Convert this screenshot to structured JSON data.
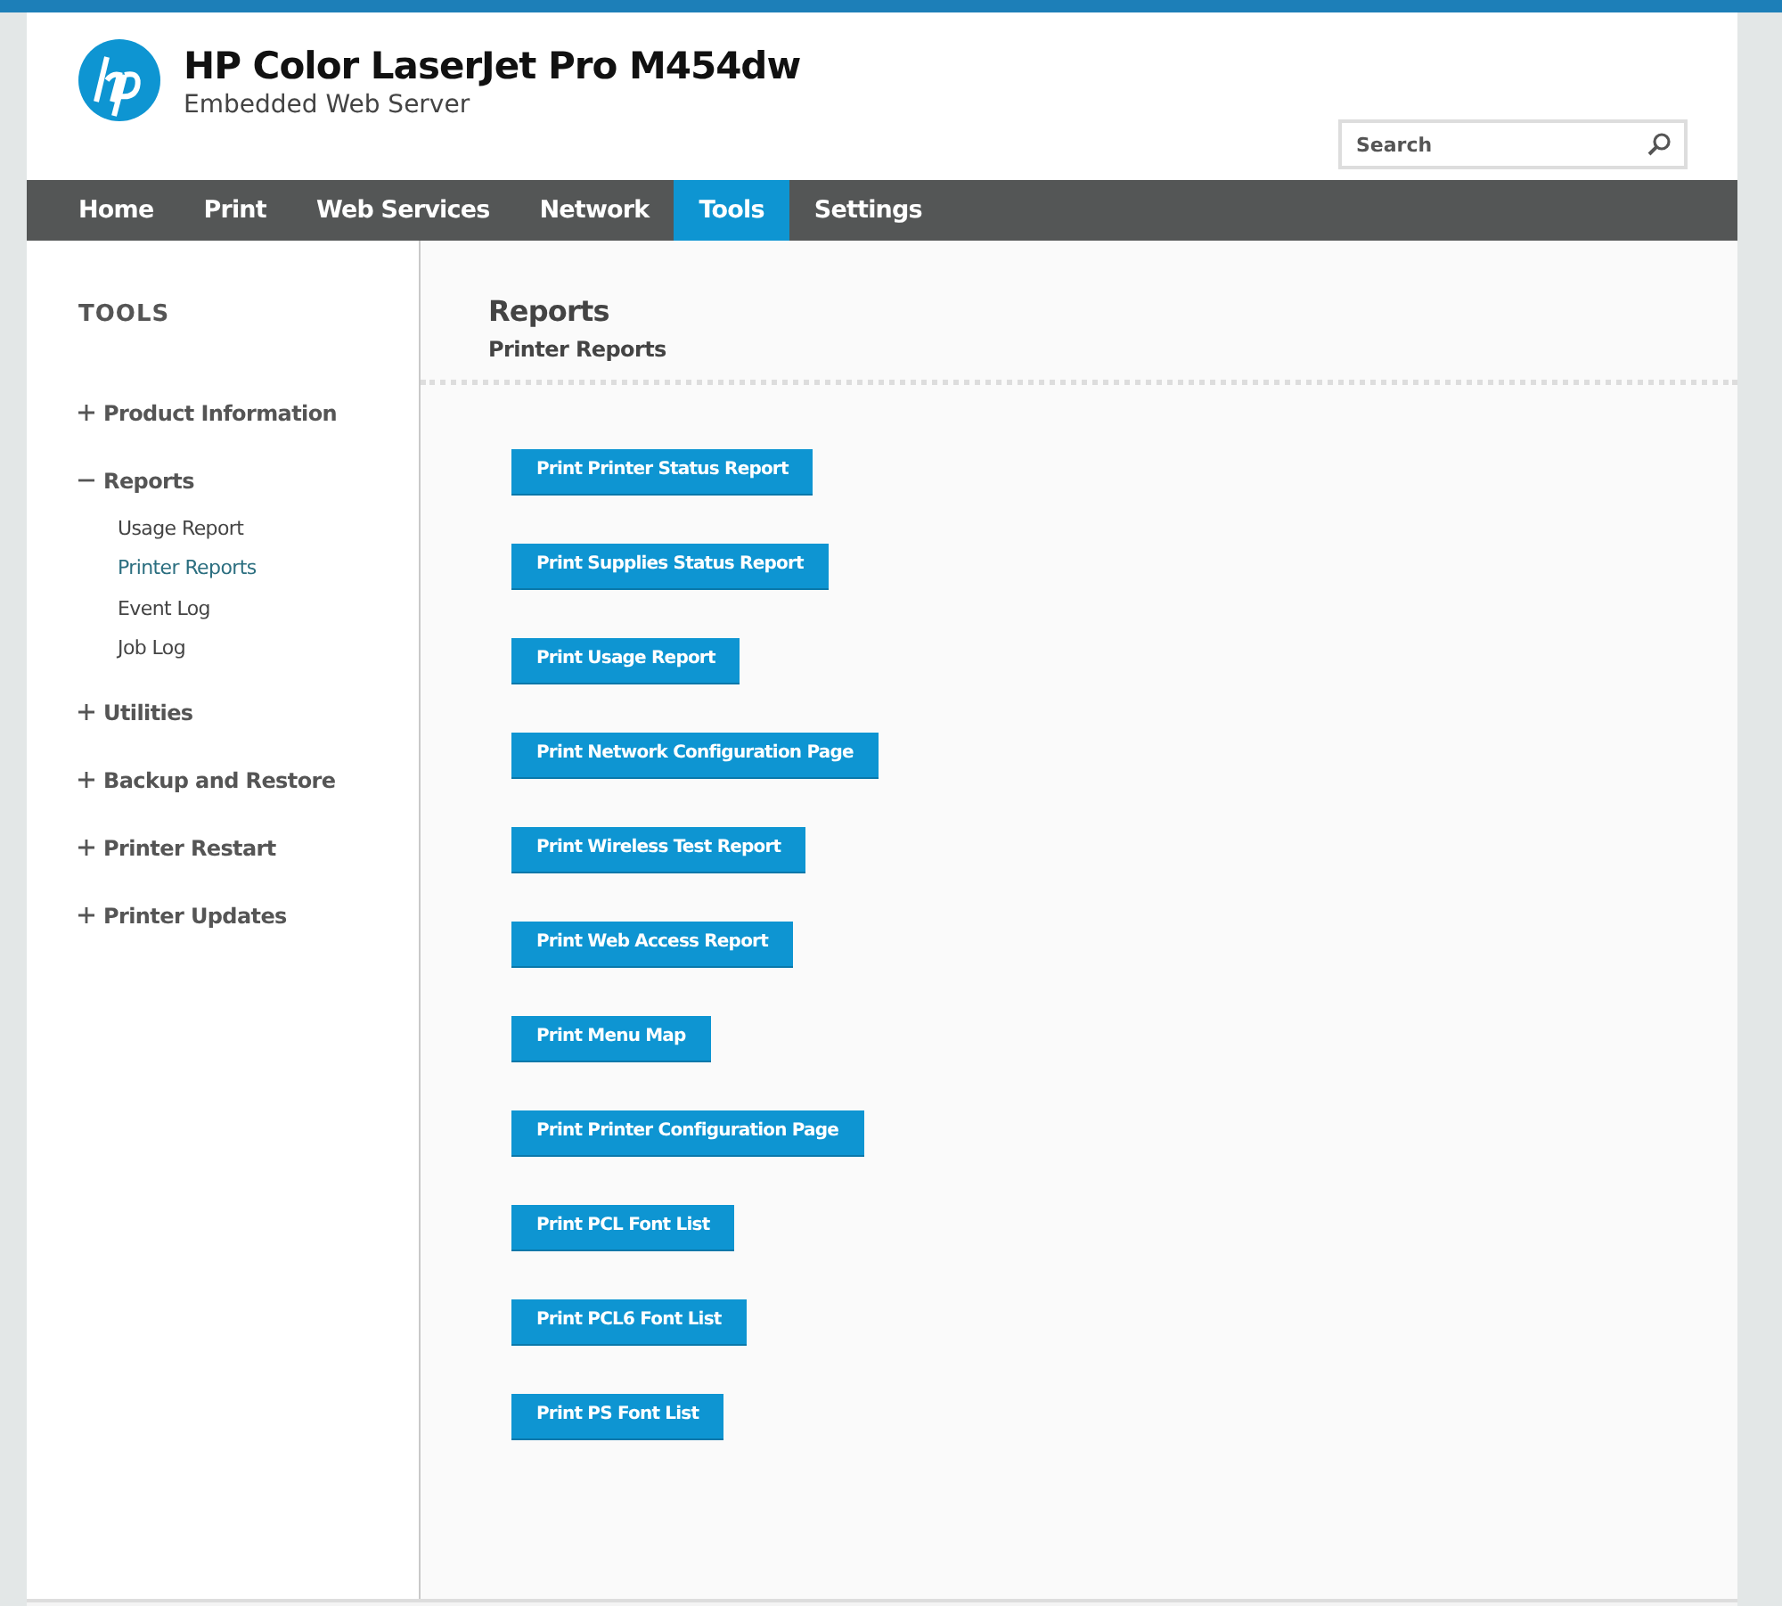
{
  "header": {
    "title": "HP Color LaserJet Pro M454dw",
    "subtitle": "Embedded Web Server"
  },
  "search": {
    "placeholder": "Search"
  },
  "tabs": [
    {
      "label": "Home",
      "selected": false
    },
    {
      "label": "Print",
      "selected": false
    },
    {
      "label": "Web Services",
      "selected": false
    },
    {
      "label": "Network",
      "selected": false
    },
    {
      "label": "Tools",
      "selected": true
    },
    {
      "label": "Settings",
      "selected": false
    }
  ],
  "sidebar": {
    "title": "TOOLS",
    "items": [
      {
        "label": "Product Information",
        "expanded": false
      },
      {
        "label": "Reports",
        "expanded": true,
        "children": [
          {
            "label": "Usage Report",
            "selected": false
          },
          {
            "label": "Printer Reports",
            "selected": true
          },
          {
            "label": "Event Log",
            "selected": false
          },
          {
            "label": "Job Log",
            "selected": false
          }
        ]
      },
      {
        "label": "Utilities",
        "expanded": false
      },
      {
        "label": "Backup and Restore",
        "expanded": false
      },
      {
        "label": "Printer Restart",
        "expanded": false
      },
      {
        "label": "Printer Updates",
        "expanded": false
      }
    ]
  },
  "content": {
    "title": "Reports",
    "subtitle": "Printer Reports",
    "buttons": [
      "Print Printer Status Report",
      "Print Supplies Status Report",
      "Print Usage Report",
      "Print Network Configuration Page",
      "Print Wireless Test Report",
      "Print Web Access Report",
      "Print Menu Map",
      "Print Printer Configuration Page",
      "Print PCL Font List",
      "Print PCL6 Font List",
      "Print PS Font List"
    ]
  }
}
